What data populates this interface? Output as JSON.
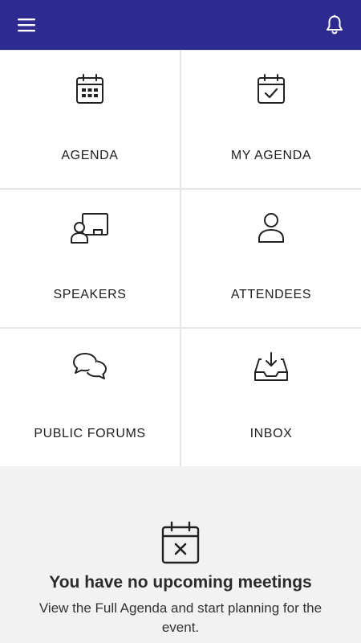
{
  "header": {
    "menu_icon": "hamburger-menu-icon",
    "notification_icon": "bell-icon",
    "background": "#2d2a90"
  },
  "tiles": [
    {
      "label": "AGENDA",
      "icon": "calendar-grid-icon"
    },
    {
      "label": "MY AGENDA",
      "icon": "calendar-check-icon"
    },
    {
      "label": "SPEAKERS",
      "icon": "presenter-board-icon"
    },
    {
      "label": "ATTENDEES",
      "icon": "person-icon"
    },
    {
      "label": "PUBLIC FORUMS",
      "icon": "chat-bubbles-icon"
    },
    {
      "label": "INBOX",
      "icon": "inbox-download-icon"
    }
  ],
  "empty_state": {
    "icon": "calendar-x-icon",
    "title": "You have no upcoming meetings",
    "subtitle": "View the Full Agenda and start planning for the event."
  }
}
